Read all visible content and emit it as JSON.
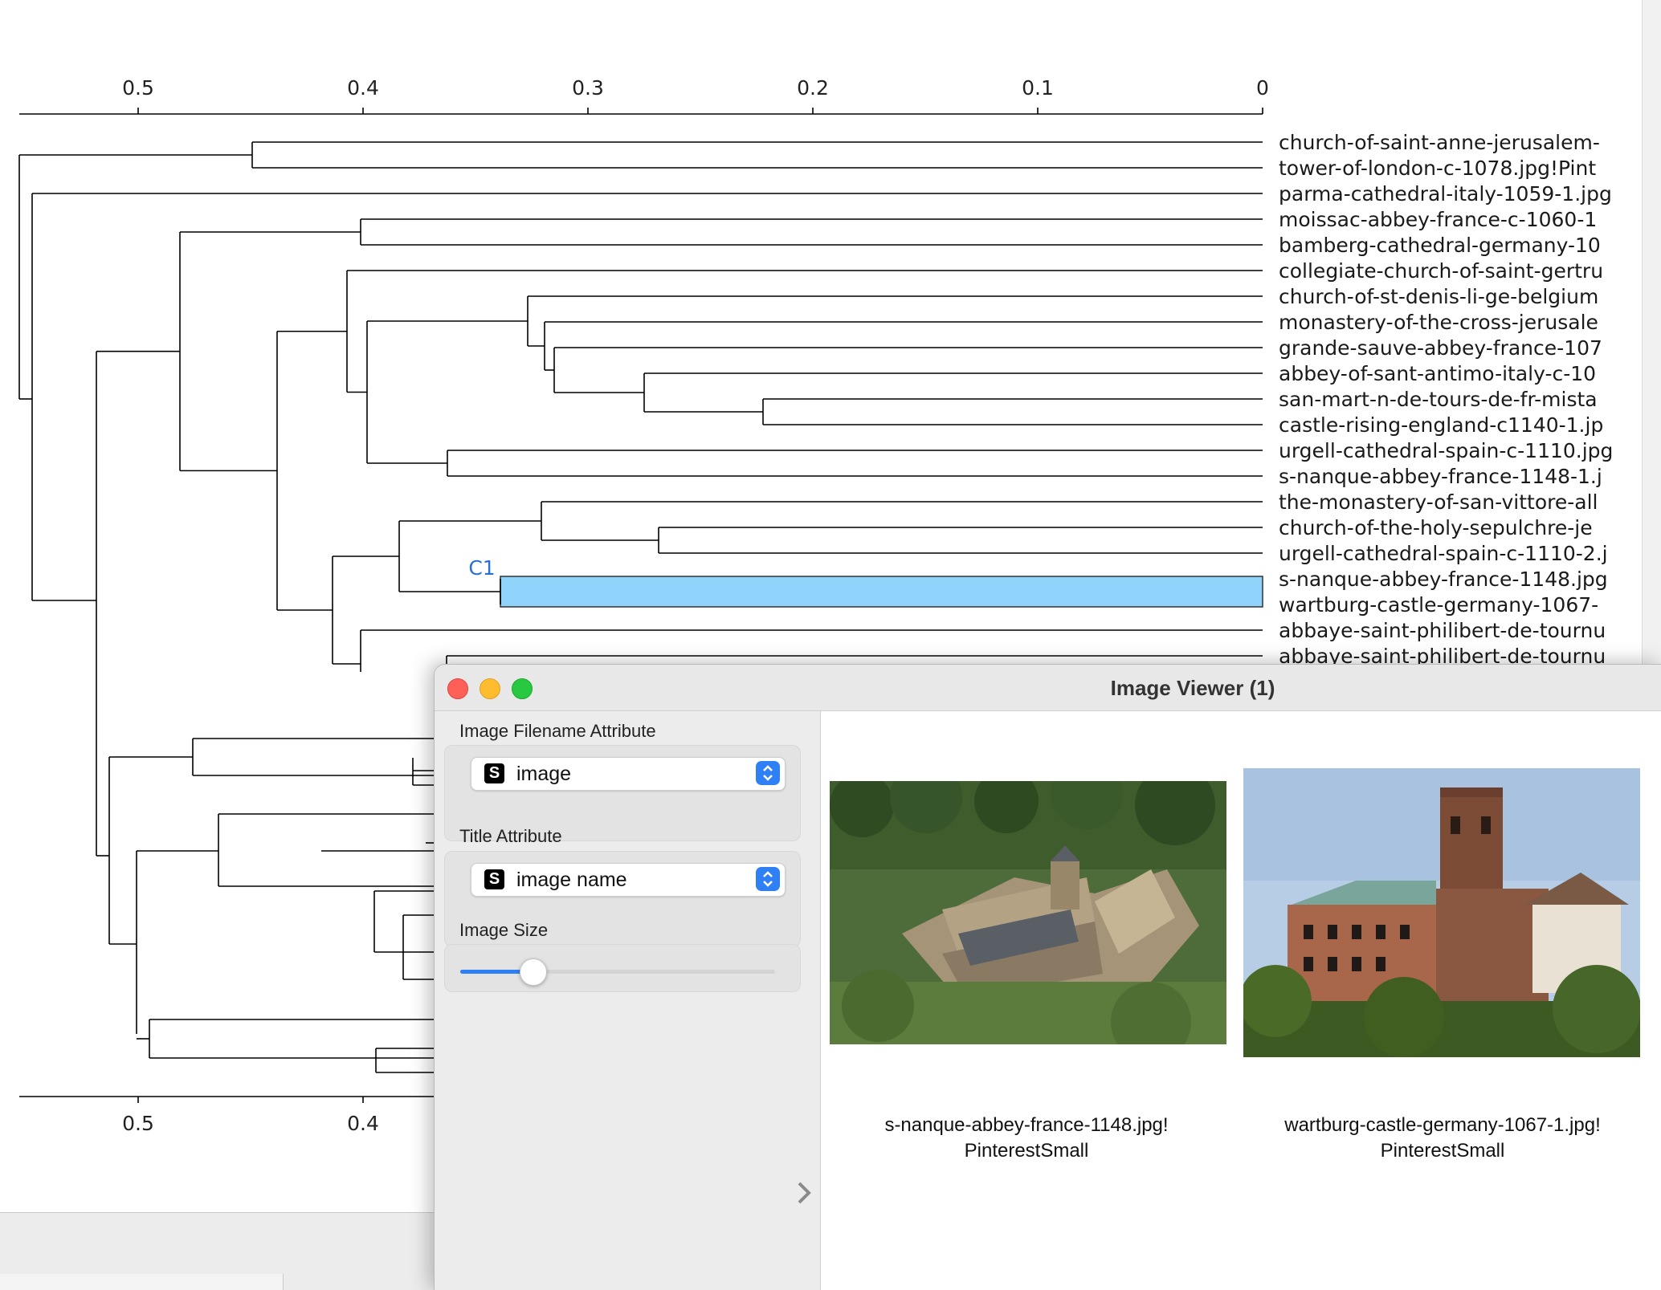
{
  "dendrogram": {
    "axis_ticks": [
      "0.5",
      "0.4",
      "0.3",
      "0.2",
      "0.1",
      "0"
    ],
    "bottom_axis_ticks": [
      "0.5",
      "0.4"
    ],
    "selection_label": "C1",
    "leaves": [
      "church-of-saint-anne-jerusalem-",
      "tower-of-london-c-1078.jpg!Pint",
      "parma-cathedral-italy-1059-1.jpg",
      "moissac-abbey-france-c-1060-1",
      "bamberg-cathedral-germany-10",
      "collegiate-church-of-saint-gertru",
      "church-of-st-denis-li-ge-belgium",
      "monastery-of-the-cross-jerusale",
      "grande-sauve-abbey-france-107",
      "abbey-of-sant-antimo-italy-c-10",
      "san-mart-n-de-tours-de-fr-mista",
      "castle-rising-england-c1140-1.jp",
      "urgell-cathedral-spain-c-1110.jpg",
      "s-nanque-abbey-france-1148-1.j",
      "the-monastery-of-san-vittore-all",
      "church-of-the-holy-sepulchre-je",
      "urgell-cathedral-spain-c-1110-2.j",
      "s-nanque-abbey-france-1148.jpg",
      "wartburg-castle-germany-1067-",
      "abbaye-saint-philibert-de-tournu",
      "abbaye-saint-philibert-de-tournu"
    ],
    "selection_color": "#8fd3fb",
    "selection_label_color": "#2a6fd6"
  },
  "viewer": {
    "title": "Image Viewer (1)",
    "filename_attr_label": "Image Filename Attribute",
    "filename_attr_value": "image",
    "filename_attr_badge": "S",
    "title_attr_label": "Title Attribute",
    "title_attr_value": "image name",
    "title_attr_badge": "S",
    "image_size_label": "Image Size",
    "image_size_fraction": 0.23,
    "images": [
      {
        "title_line1": "s-nanque-abbey-france-1148.jpg!",
        "title_line2": "PinterestSmall"
      },
      {
        "title_line1": "wartburg-castle-germany-1067-1.jpg!",
        "title_line2": "PinterestSmall"
      }
    ]
  }
}
